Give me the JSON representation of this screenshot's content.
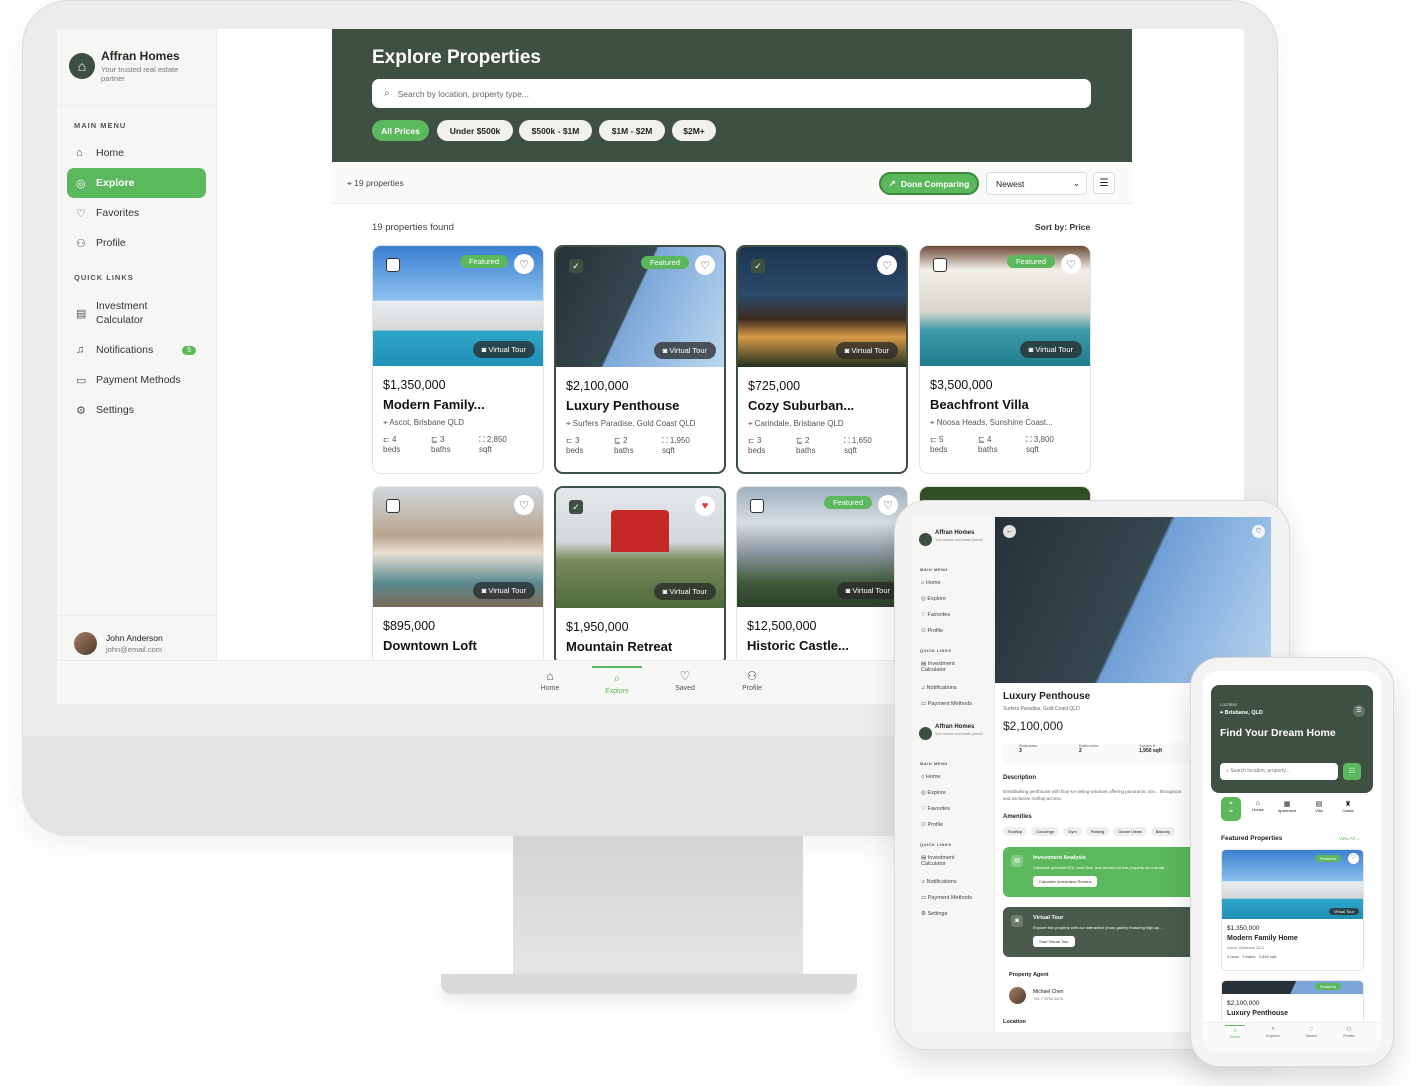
{
  "app": {
    "brand": "Affran Homes",
    "tagline": "Your trusted real estate partner"
  },
  "sidebar": {
    "main_menu_label": "MAIN MENU",
    "main_items": [
      {
        "label": "Home",
        "icon": "home-icon"
      },
      {
        "label": "Explore",
        "icon": "compass-icon",
        "active": true
      },
      {
        "label": "Favorites",
        "icon": "heart-icon"
      },
      {
        "label": "Profile",
        "icon": "user-icon"
      }
    ],
    "quick_links_label": "QUICK LINKS",
    "quick_items": [
      {
        "label": "Investment Calculator",
        "icon": "calculator-icon"
      },
      {
        "label": "Notifications",
        "icon": "bell-icon",
        "badge": "5"
      },
      {
        "label": "Payment Methods",
        "icon": "credit-card-icon"
      },
      {
        "label": "Settings",
        "icon": "gear-icon"
      }
    ],
    "user": {
      "name": "John Anderson",
      "email": "john@email.com"
    }
  },
  "hero": {
    "title": "Explore Properties",
    "search_placeholder": "Search by location, property type...",
    "filters": [
      "All Prices",
      "Under $500k",
      "$500k - $1M",
      "$1M - $2M",
      "$2M+"
    ],
    "active_filter": "All Prices"
  },
  "toolbar": {
    "count": "19 properties",
    "compare_label": "Done Comparing",
    "sort_value": "Newest"
  },
  "results": {
    "found": "19 properties found",
    "sort_by": "Sort by: Price"
  },
  "labels": {
    "featured": "Featured",
    "virtual_tour": "Virtual Tour",
    "beds": "beds",
    "baths": "baths",
    "sqft": "sqft"
  },
  "properties": [
    {
      "price": "$1,350,000",
      "title": "Modern Family...",
      "location": "Ascot, Brisbane QLD",
      "beds": "4",
      "baths": "3",
      "sqft": "2,850",
      "featured": true,
      "selected": false,
      "favorite": false
    },
    {
      "price": "$2,100,000",
      "title": "Luxury Penthouse",
      "location": "Surfers Paradise, Gold Coast QLD",
      "beds": "3",
      "baths": "2",
      "sqft": "1,950",
      "featured": true,
      "selected": true,
      "favorite": false
    },
    {
      "price": "$725,000",
      "title": "Cozy Suburban...",
      "location": "Carindale, Brisbane QLD",
      "beds": "3",
      "baths": "2",
      "sqft": "1,650",
      "featured": false,
      "selected": true,
      "favorite": false
    },
    {
      "price": "$3,500,000",
      "title": "Beachfront Villa",
      "location": "Noosa Heads, Sunshine Coast...",
      "beds": "5",
      "baths": "4",
      "sqft": "3,800",
      "featured": true,
      "selected": false,
      "favorite": false
    },
    {
      "price": "$895,000",
      "title": "Downtown Loft",
      "location": "",
      "featured": false,
      "selected": false,
      "favorite": false
    },
    {
      "price": "$1,950,000",
      "title": "Mountain Retreat",
      "location": "",
      "featured": false,
      "selected": true,
      "favorite": true
    },
    {
      "price": "$12,500,000",
      "title": "Historic Castle...",
      "location": "",
      "featured": true,
      "selected": false,
      "favorite": false
    }
  ],
  "bottom_nav": [
    {
      "label": "Home",
      "icon": "home-icon"
    },
    {
      "label": "Explore",
      "icon": "search-icon",
      "active": true
    },
    {
      "label": "Saved",
      "icon": "heart-icon"
    },
    {
      "label": "Profile",
      "icon": "user-icon"
    }
  ],
  "tablet": {
    "menu": [
      "Home",
      "Explore",
      "Favorites",
      "Profile"
    ],
    "quick": [
      "Investment Calculator",
      "Notifications",
      "Payment Methods",
      "Settings"
    ],
    "title": "Luxury Penthouse",
    "location": "Surfers Paradise, Gold Coast QLD",
    "price": "$2,100,000",
    "bed_label": "Bedrooms",
    "bed_value": "3",
    "bath_label": "Bathrooms",
    "bath_value": "2",
    "sqft_label": "Square ft",
    "sqft_value": "1,950 sqft",
    "description_label": "Description",
    "description": "Breathtaking penthouse with floor-to-ceiling windows offering panoramic oce... throughout and exclusive rooftop access.",
    "amenities_label": "Amenities",
    "amenities": [
      "Rooftop",
      "Concierge",
      "Gym",
      "Parking",
      "Ocean Views",
      "Balcony"
    ],
    "invest_title": "Investment Analysis",
    "invest_text": "Calculate potential ROI, cash flow, and returns for this property as a rental...",
    "invest_btn": "Calculate Investment Returns",
    "tour_title": "Virtual Tour",
    "tour_text": "Explore this property with our interactive photo gallery featuring high-qu...",
    "tour_btn": "Start Virtual Tour",
    "agent_label": "Property Agent",
    "agent_name": "Michael Chen",
    "agent_phone": "+61 7 5234 5678",
    "location_label": "Location"
  },
  "phone": {
    "location_label": "Location",
    "location": "Brisbane, QLD",
    "title": "Find Your Dream Home",
    "search_placeholder": "Search location, property...",
    "categories": [
      "All",
      "House",
      "Apartment",
      "Villa",
      "Castle"
    ],
    "featured_label": "Featured Properties",
    "view_all": "View All →",
    "card1_price": "$1,350,000",
    "card1_title": "Modern Family Home",
    "card1_location": "Ascot, Brisbane QLD",
    "card1_stats": "4 beds   3 baths   2,850 sqft",
    "card2_price": "$2,100,000",
    "card2_title": "Luxury Penthouse",
    "nav": [
      "Home",
      "Explore",
      "Saved",
      "Profile"
    ]
  }
}
